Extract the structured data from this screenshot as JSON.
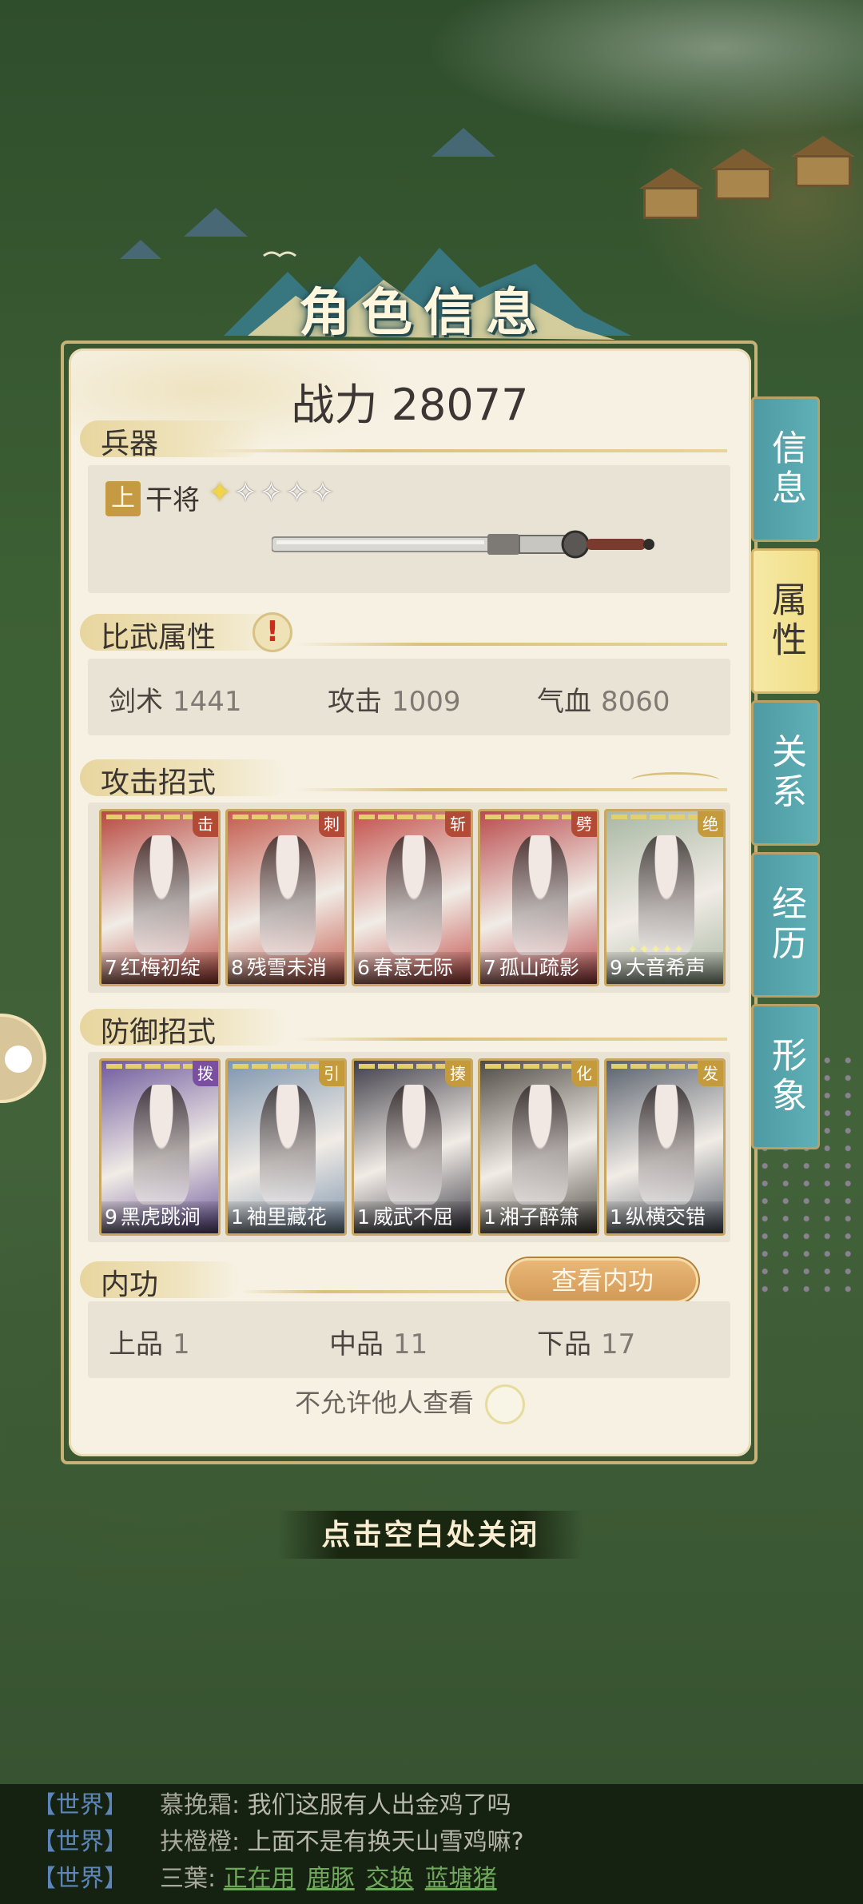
{
  "title": "角色信息",
  "power": "战力 28077",
  "weapon": {
    "section_label": "兵器",
    "grade": "上",
    "name": "干将",
    "stars_filled": 1,
    "stars_total": 5
  },
  "combat_attributes": {
    "section_label": "比武属性",
    "alert": "!",
    "stats": [
      {
        "label": "剑术",
        "value": "1441"
      },
      {
        "label": "攻击",
        "value": "1009"
      },
      {
        "label": "气血",
        "value": "8060"
      }
    ]
  },
  "attack_moves": {
    "section_label": "攻击招式",
    "cards": [
      {
        "level": "7",
        "name": "红梅初绽",
        "tag": "击",
        "tag_color": "#b24a35",
        "art_color": "#b8483f"
      },
      {
        "level": "8",
        "name": "残雪未消",
        "tag": "刺",
        "tag_color": "#b24a35",
        "art_color": "#c45a4d"
      },
      {
        "level": "6",
        "name": "春意无际",
        "tag": "斩",
        "tag_color": "#b24a35",
        "art_color": "#c34f4a"
      },
      {
        "level": "7",
        "name": "孤山疏影",
        "tag": "劈",
        "tag_color": "#b24a35",
        "art_color": "#b94b4c"
      },
      {
        "level": "9",
        "name": "大音希声",
        "tag": "绝",
        "tag_color": "#c49a3a",
        "art_color": "#a8b7a2",
        "stars": "✦✦✦✦✦"
      }
    ]
  },
  "defense_moves": {
    "section_label": "防御招式",
    "cards": [
      {
        "level": "9",
        "name": "黑虎跳涧",
        "tag": "拨",
        "tag_color": "#7a4fa1",
        "art_color": "#6f5a9e"
      },
      {
        "level": "1",
        "name": "袖里藏花",
        "tag": "引",
        "tag_color": "#c49a3a",
        "art_color": "#7e95ae"
      },
      {
        "level": "1",
        "name": "威武不屈",
        "tag": "揍",
        "tag_color": "#c49a3a",
        "art_color": "#3f3d48"
      },
      {
        "level": "1",
        "name": "湘子醉箫",
        "tag": "化",
        "tag_color": "#c49a3a",
        "art_color": "#4e4a44"
      },
      {
        "level": "1",
        "name": "纵横交错",
        "tag": "发",
        "tag_color": "#c49a3a",
        "art_color": "#58606d"
      }
    ]
  },
  "inner_power": {
    "section_label": "内功",
    "view_button": "查看内功",
    "grades": [
      {
        "label": "上品",
        "value": "1"
      },
      {
        "label": "中品",
        "value": "11"
      },
      {
        "label": "下品",
        "value": "17"
      }
    ]
  },
  "privacy_label": "不允许他人查看",
  "tabs": [
    {
      "label": "信息",
      "active": false
    },
    {
      "label": "属性",
      "active": true
    },
    {
      "label": "关系",
      "active": false
    },
    {
      "label": "经历",
      "active": false
    },
    {
      "label": "形象",
      "active": false
    }
  ],
  "close_hint": "点击空白处关闭",
  "chat": [
    {
      "channel": "【世界】",
      "user": "慕挽霜:",
      "message": "我们这服有人出金鸡了吗"
    },
    {
      "channel": "【世界】",
      "user": "扶橙橙:",
      "message": "上面不是有换天山雪鸡嘛?"
    },
    {
      "channel": "【世界】",
      "user": "三葉:",
      "links": [
        "正在用",
        "鹿豚",
        "交换",
        "蓝塘猪"
      ]
    }
  ]
}
